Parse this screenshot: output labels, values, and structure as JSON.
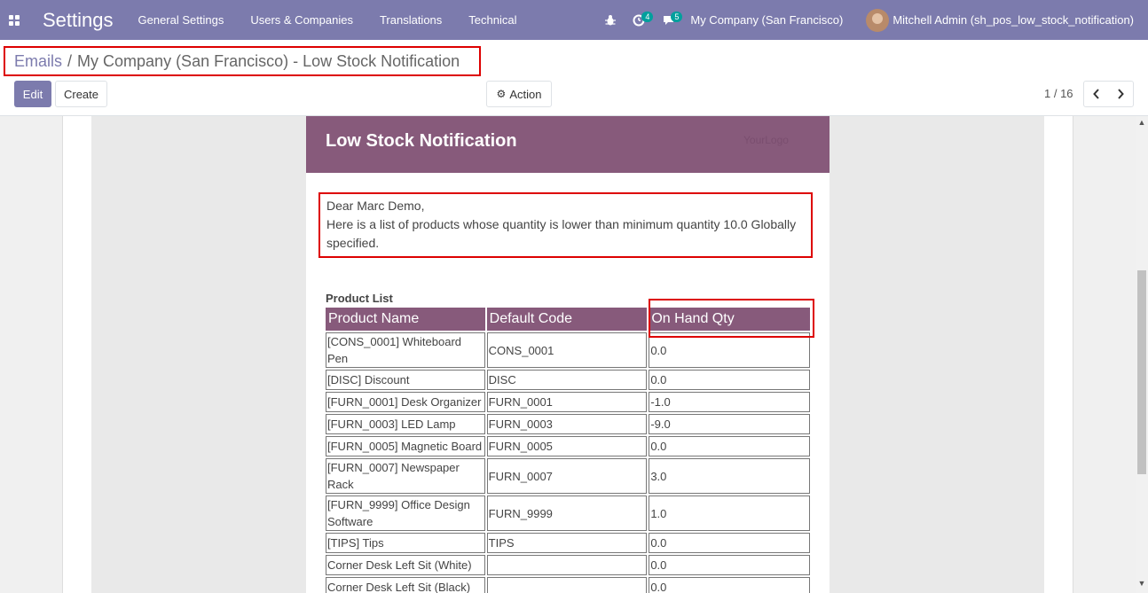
{
  "navbar": {
    "app_title": "Settings",
    "menu": [
      "General Settings",
      "Users & Companies",
      "Translations",
      "Technical"
    ],
    "activity_count": "4",
    "message_count": "5",
    "company": "My Company (San Francisco)",
    "user": "Mitchell Admin (sh_pos_low_stock_notification)",
    "colors": {
      "brand": "#7c7bad",
      "badge": "#00a09d"
    }
  },
  "breadcrumb": {
    "parent": "Emails",
    "separator": "/",
    "current": "My Company (San Francisco) - Low Stock Notification"
  },
  "toolbar": {
    "edit_label": "Edit",
    "create_label": "Create",
    "action_label": "Action",
    "pager": "1 / 16"
  },
  "email": {
    "title": "Low Stock Notification",
    "logo_text": "YourLogo",
    "greeting": "Dear Marc Demo,",
    "message": "Here is a list of products whose quantity is lower than minimum quantity 10.0 Globally specified.",
    "list_title": "Product List",
    "header_color": "#875a7b",
    "columns": [
      "Product Name",
      "Default Code",
      "On Hand Qty"
    ],
    "rows": [
      [
        "[CONS_0001] Whiteboard Pen",
        "CONS_0001",
        "0.0"
      ],
      [
        "[DISC] Discount",
        "DISC",
        "0.0"
      ],
      [
        "[FURN_0001] Desk Organizer",
        "FURN_0001",
        "-1.0"
      ],
      [
        "[FURN_0003] LED Lamp",
        "FURN_0003",
        "-9.0"
      ],
      [
        "[FURN_0005] Magnetic Board",
        "FURN_0005",
        "0.0"
      ],
      [
        "[FURN_0007] Newspaper Rack",
        "FURN_0007",
        "3.0"
      ],
      [
        "[FURN_9999] Office Design Software",
        "FURN_9999",
        "1.0"
      ],
      [
        "[TIPS] Tips",
        "TIPS",
        "0.0"
      ],
      [
        "Corner Desk Left Sit (White)",
        "",
        "0.0"
      ],
      [
        "Corner Desk Left Sit (Black)",
        "",
        "0.0"
      ],
      [
        "",
        "",
        ""
      ]
    ]
  }
}
